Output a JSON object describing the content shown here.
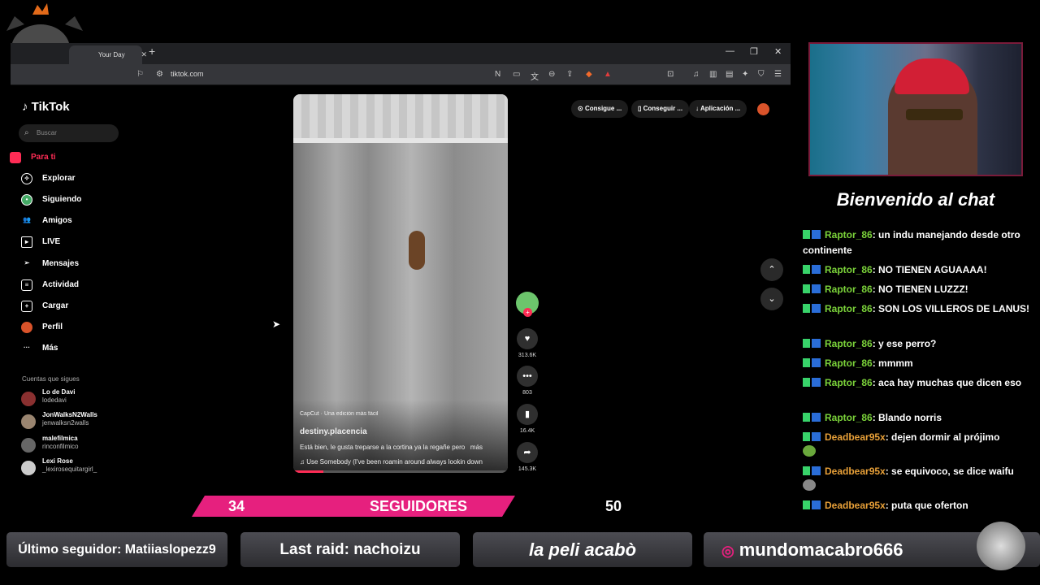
{
  "browser": {
    "tab_title": "Your Day",
    "url": "tiktok.com"
  },
  "tiktok": {
    "logo": "TikTok",
    "search_placeholder": "Buscar",
    "nav": [
      {
        "label": "Para ti",
        "icon": "home-icon"
      },
      {
        "label": "Explorar",
        "icon": "compass-icon"
      },
      {
        "label": "Siguiendo",
        "icon": "following-icon"
      },
      {
        "label": "Amigos",
        "icon": "friends-icon"
      },
      {
        "label": "LIVE",
        "icon": "live-icon"
      },
      {
        "label": "Mensajes",
        "icon": "message-icon"
      },
      {
        "label": "Actividad",
        "icon": "activity-icon"
      },
      {
        "label": "Cargar",
        "icon": "upload-icon"
      },
      {
        "label": "Perfil",
        "icon": "profile-icon"
      },
      {
        "label": "Más",
        "icon": "more-icon"
      }
    ],
    "following_heading": "Cuentas que sigues",
    "accounts": [
      {
        "name": "Lo de Davi",
        "handle": "lodedavi"
      },
      {
        "name": "JonWalksN2Walls",
        "handle": "jenwalksn2walls"
      },
      {
        "name": "malefilmica",
        "handle": "rinconfilmico"
      },
      {
        "name": "Lexi Rose",
        "handle": "_lexirosequitargirl_"
      }
    ],
    "promos": [
      "Consigue ...",
      "Conseguir ...",
      "Aplicación ..."
    ],
    "video": {
      "watermark": "CapCut · Una edición más fácil",
      "author": "destiny.placencia",
      "caption": "Está bien, le gusta treparse a la cortina ya la regañe pero",
      "more": "más",
      "music": "♫ Use Somebody (I've been roamin around always lookin down",
      "progress": 0.14
    },
    "actions": {
      "likes": "313.6K",
      "comments": "803",
      "saves": "16.4K",
      "shares": "145.3K"
    }
  },
  "chat": {
    "title": "Bienvenido al chat",
    "messages": [
      {
        "user": "Raptor_86",
        "text": ": un indu manejando desde otro continente",
        "type": "raptor"
      },
      {
        "user": "Raptor_86",
        "text": ": NO TIENEN AGUAAAA!",
        "type": "raptor"
      },
      {
        "user": "Raptor_86",
        "text": ": NO TIENEN LUZZZ!",
        "type": "raptor"
      },
      {
        "user": "Raptor_86",
        "text": ": SON LOS VILLEROS DE LANUS!",
        "type": "raptor"
      },
      {
        "user": "Raptor_86",
        "text": ": y ese perro?",
        "type": "raptor"
      },
      {
        "user": "Raptor_86",
        "text": ": mmmm",
        "type": "raptor"
      },
      {
        "user": "Raptor_86",
        "text": ": aca hay muchas que dicen eso",
        "type": "raptor"
      },
      {
        "user": "Raptor_86",
        "text": ": Blando norris",
        "type": "raptor"
      },
      {
        "user": "Deadbear95x",
        "text": ": dejen dormir al prójimo",
        "type": "dead"
      },
      {
        "user": "Deadbear95x",
        "text": ": se equivoco, se dice waifu",
        "type": "dead"
      },
      {
        "user": "Deadbear95x",
        "text": ": puta que oferton",
        "type": "dead"
      }
    ]
  },
  "overlay": {
    "followers_current": "34",
    "followers_label": "SEGUIDORES",
    "followers_goal": "50",
    "last_follower": "Último seguidor: Matiiaslopezz9",
    "last_raid": "Last raid: nachoizu",
    "movie": "la peli acabò",
    "instagram": "mundomacabro666"
  },
  "colors": {
    "tiktok_red": "#fe2c55",
    "follow_bar": "#e6207e",
    "raptor_name": "#7bd33a",
    "deadbear_name": "#e8a038"
  }
}
